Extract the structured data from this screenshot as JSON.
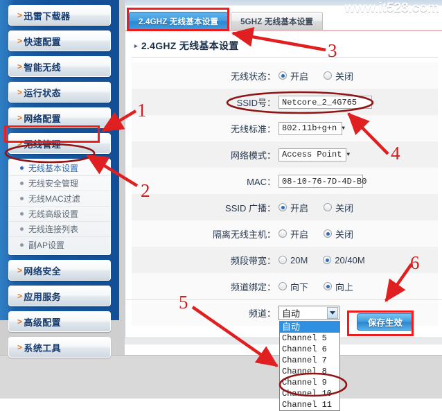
{
  "watermark": "www.it528.com",
  "sidebar": {
    "top_items": [
      {
        "label": "迅雷下载器",
        "caret": ">"
      },
      {
        "label": "快速配置",
        "caret": ">"
      },
      {
        "label": "智能无线",
        "caret": ">"
      },
      {
        "label": "运行状态",
        "caret": ">"
      },
      {
        "label": "网络配置",
        "caret": ">"
      },
      {
        "label": "无线管理",
        "caret": ">"
      }
    ],
    "submenu": [
      {
        "label": "无线基本设置",
        "selected": true
      },
      {
        "label": "无线安全管理",
        "selected": false
      },
      {
        "label": "无线MAC过滤",
        "selected": false
      },
      {
        "label": "无线高级设置",
        "selected": false
      },
      {
        "label": "无线连接列表",
        "selected": false
      },
      {
        "label": "副AP设置",
        "selected": false
      }
    ],
    "bottom_items": [
      {
        "label": "网络安全",
        "caret": ">"
      },
      {
        "label": "应用服务",
        "caret": ">"
      },
      {
        "label": "高级配置",
        "caret": ">"
      },
      {
        "label": "系统工具",
        "caret": ">"
      }
    ]
  },
  "tabs": [
    {
      "label": "2.4GHZ 无线基本设置",
      "active": true
    },
    {
      "label": "5GHZ 无线基本设置",
      "active": false
    }
  ],
  "section": {
    "triangle": "▸",
    "title": "2.4GHZ 无线基本设置"
  },
  "form": {
    "wireless_status": {
      "label": "无线状态：",
      "options": [
        {
          "label": "开启",
          "checked": true
        },
        {
          "label": "关闭",
          "checked": false
        }
      ]
    },
    "ssid": {
      "label": "SSID号：",
      "value": "Netcore_2_4G765"
    },
    "wireless_standard": {
      "label": "无线标准：",
      "value": "802.11b+g+n",
      "arrow": "▼"
    },
    "network_mode": {
      "label": "网络模式：",
      "value": "Access Point",
      "arrow": "▼"
    },
    "mac": {
      "label": "MAC：",
      "value": "08-10-76-7D-4D-B0"
    },
    "ssid_broadcast": {
      "label": "SSID 广播：",
      "options": [
        {
          "label": "开启",
          "checked": true
        },
        {
          "label": "关闭",
          "checked": false
        }
      ]
    },
    "isolate_host": {
      "label": "隔离无线主机：",
      "options": [
        {
          "label": "开启",
          "checked": false
        },
        {
          "label": "关闭",
          "checked": true
        }
      ]
    },
    "band_width": {
      "label": "频段带宽：",
      "options": [
        {
          "label": "20M",
          "checked": false
        },
        {
          "label": "20/40M",
          "checked": true
        }
      ]
    },
    "channel_binding": {
      "label": "频道绑定：",
      "options": [
        {
          "label": "向下",
          "checked": false
        },
        {
          "label": "向上",
          "checked": true
        }
      ]
    },
    "channel": {
      "label": "频道：",
      "value": "自动",
      "options": [
        {
          "label": "自动",
          "selected": true
        },
        {
          "label": "Channel 5",
          "selected": false
        },
        {
          "label": "Channel 6",
          "selected": false
        },
        {
          "label": "Channel 7",
          "selected": false
        },
        {
          "label": "Channel 8",
          "selected": false
        },
        {
          "label": "Channel 9",
          "selected": false
        },
        {
          "label": "Channel 10",
          "selected": false
        },
        {
          "label": "Channel 11",
          "selected": false
        }
      ]
    }
  },
  "save_button": {
    "label": "保存生效"
  },
  "annotations": {
    "numbers": [
      {
        "id": "1",
        "text": "1"
      },
      {
        "id": "2",
        "text": "2"
      },
      {
        "id": "3",
        "text": "3"
      },
      {
        "id": "4",
        "text": "4"
      },
      {
        "id": "5",
        "text": "5"
      },
      {
        "id": "6",
        "text": "6"
      }
    ]
  },
  "colors": {
    "annotation_red": "#ee1c1c",
    "annotation_number_red": "#cc2121",
    "sidebar_blue": "#14539c",
    "tab_active_blue": "#3f9adf",
    "dropdown_highlight": "#2f8fe0"
  }
}
